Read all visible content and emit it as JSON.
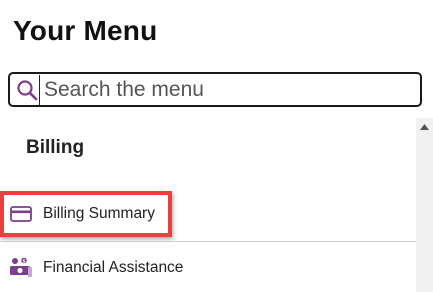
{
  "header": {
    "title": "Your Menu"
  },
  "search": {
    "placeholder": "Search the menu",
    "value": ""
  },
  "menu": {
    "section_title": "Billing",
    "items": [
      {
        "label": "Billing Summary",
        "icon": "credit-card-icon",
        "highlighted": true
      },
      {
        "label": "Financial Assistance",
        "icon": "financial-assistance-icon",
        "highlighted": false
      }
    ]
  },
  "colors": {
    "accent_purple": "#7b3f8c",
    "highlight_red": "#e8403f",
    "text": "#222222"
  }
}
